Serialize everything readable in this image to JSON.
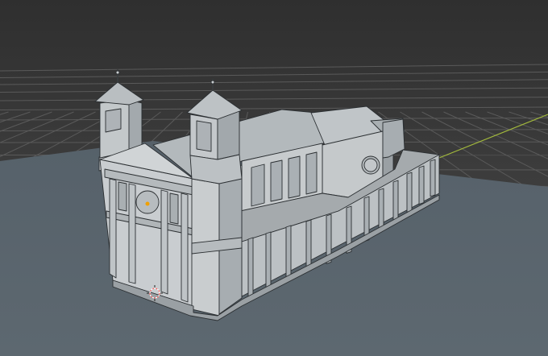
{
  "viewport": {
    "name": "3D Viewport",
    "shading": "solid-wireframe",
    "colors": {
      "sky_top": "#303030",
      "sky_horizon": "#4a4a4a",
      "ground": "#5b666e",
      "ground_far": "#566069",
      "grid_line": "#595959",
      "x_axis": "#a0b83a",
      "mesh_light": "#c8ccce",
      "mesh_mid": "#aeb3b6",
      "mesh_dark": "#8e9498",
      "roof": "#b4babd",
      "edge": "#2a2e31",
      "origin_dot": "#f0a000"
    }
  },
  "scene": {
    "object": "church-model",
    "icons": [
      "3d-cursor-icon",
      "object-origin-icon"
    ]
  }
}
